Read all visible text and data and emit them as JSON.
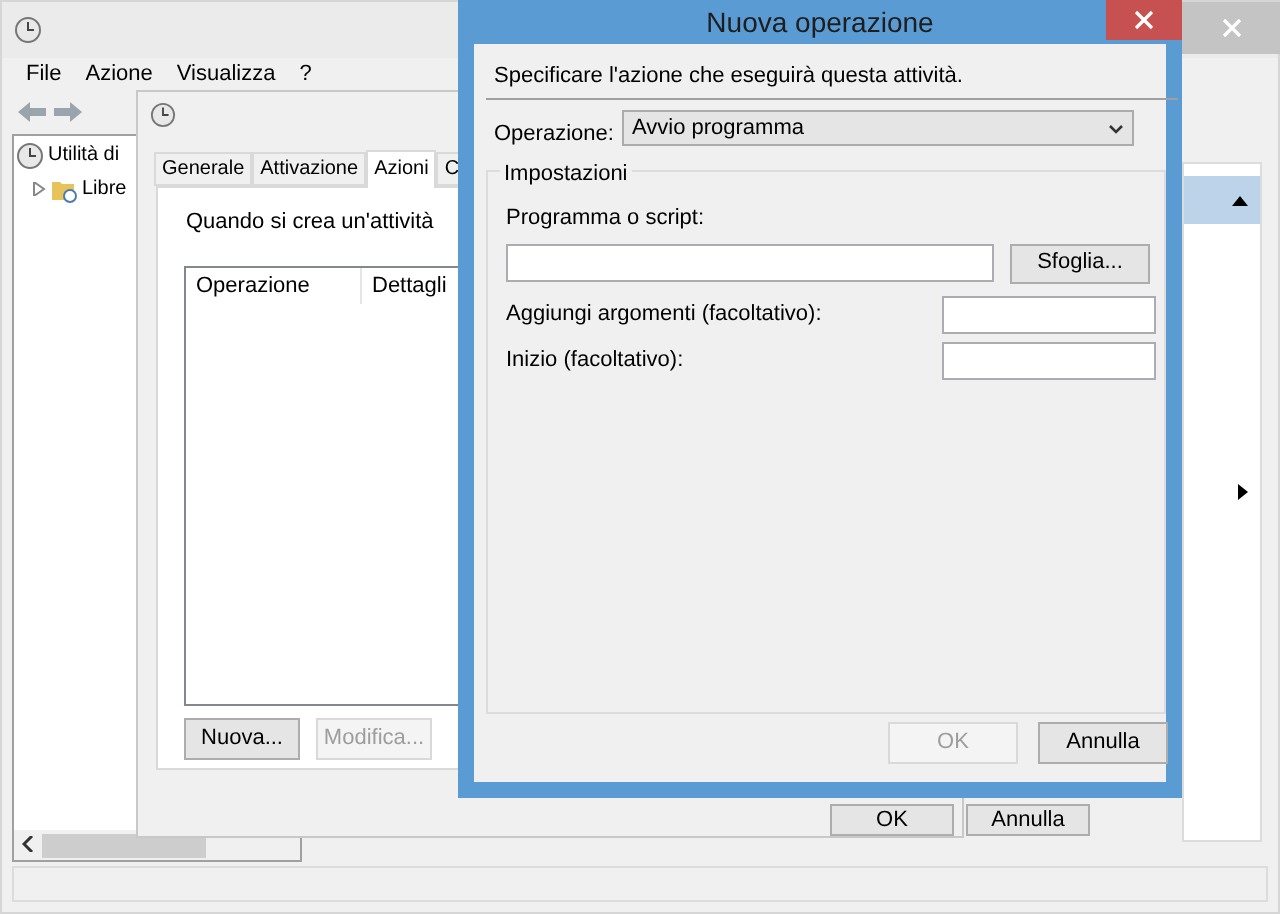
{
  "main_window": {
    "menu": [
      "File",
      "Azione",
      "Visualizza",
      "?"
    ],
    "tree": [
      {
        "label": "Utilità di",
        "expanded": true,
        "children": [
          {
            "label": "Libre",
            "expanded": false
          }
        ]
      }
    ]
  },
  "properties_dialog": {
    "tabs": [
      {
        "label": "Generale",
        "selected": false
      },
      {
        "label": "Attivazione",
        "selected": false
      },
      {
        "label": "Azioni",
        "selected": true
      },
      {
        "label": "C",
        "selected": false
      }
    ],
    "intro": "Quando si crea un'attività",
    "columns": [
      "Operazione",
      "Dettagli"
    ],
    "buttons": [
      {
        "label": "Nuova...",
        "disabled": false
      },
      {
        "label": "Modifica...",
        "disabled": true
      }
    ],
    "footer_buttons": [
      {
        "label": "OK",
        "disabled": false
      },
      {
        "label": "Annulla",
        "disabled": false
      }
    ]
  },
  "new_action_dialog": {
    "title": "Nuova operazione",
    "instruction": "Specificare l'azione che eseguirà questa attività.",
    "operation": {
      "label": "Operazione:",
      "value": "Avvio programma"
    },
    "group": "Impostazioni",
    "fields": [
      {
        "kind": "stacked",
        "label": "Programma o script:",
        "button": "Sfoglia..."
      },
      {
        "kind": "inline",
        "label": "Aggiungi argomenti (facoltativo):"
      },
      {
        "kind": "inline",
        "label": "Inizio (facoltativo):"
      }
    ],
    "buttons": [
      {
        "label": "OK",
        "disabled": true
      },
      {
        "label": "Annulla",
        "disabled": false
      }
    ]
  }
}
